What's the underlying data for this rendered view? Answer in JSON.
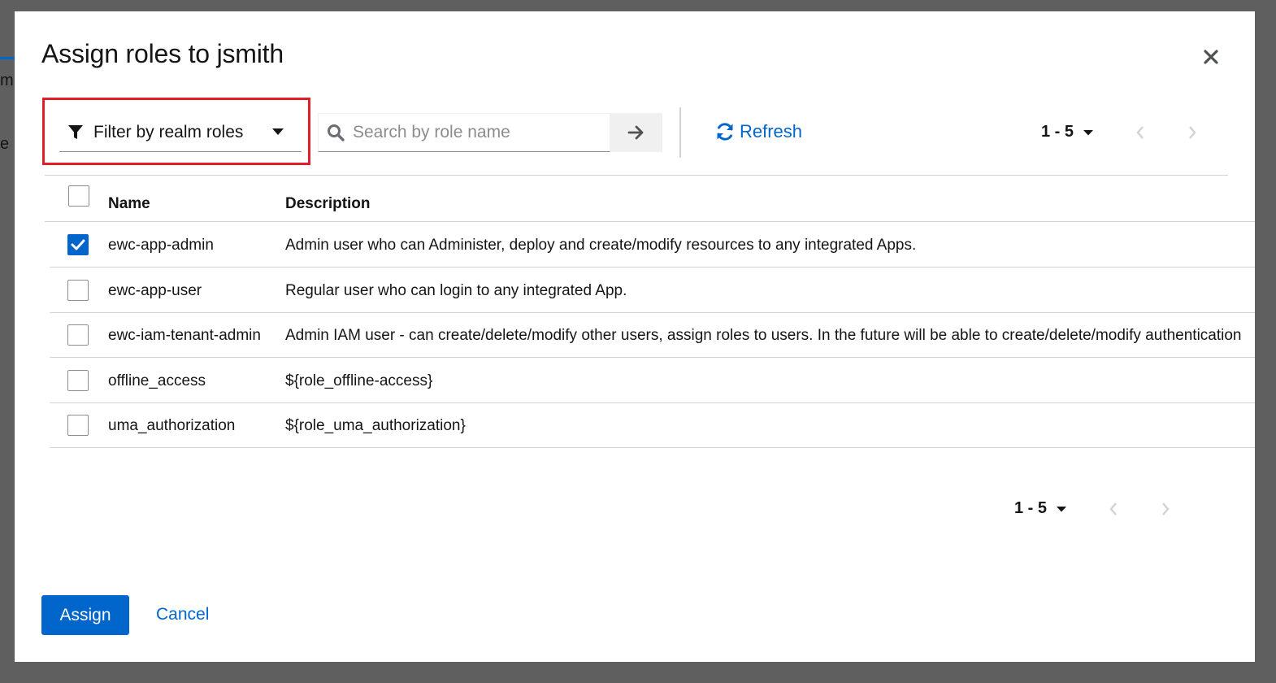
{
  "background_page": {
    "fragment_1": "m",
    "fragment_2": "e i"
  },
  "modal": {
    "title": "Assign roles to jsmith",
    "close_icon": "close-icon"
  },
  "toolbar": {
    "filter_label": "Filter by realm roles",
    "filter_icon": "filter-icon",
    "search_placeholder": "Search by role name",
    "search_value": "",
    "refresh_label": "Refresh",
    "pagination_range": "1 - 5"
  },
  "table": {
    "columns": [
      "Name",
      "Description"
    ],
    "rows": [
      {
        "name": "ewc-app-admin",
        "description": "Admin user who can Administer, deploy and create/modify resources to any integrated Apps.",
        "checked": true
      },
      {
        "name": "ewc-app-user",
        "description": "Regular user who can login to any integrated App.",
        "checked": false
      },
      {
        "name": "ewc-iam-tenant-admin",
        "description": "Admin IAM user - can create/delete/modify other users, assign roles to users. In the future will be able to create/delete/modify authentication",
        "checked": false
      },
      {
        "name": "offline_access",
        "description": "${role_offline-access}",
        "checked": false
      },
      {
        "name": "uma_authorization",
        "description": "${role_uma_authorization}",
        "checked": false
      }
    ]
  },
  "footer_pagination": {
    "range": "1 - 5"
  },
  "actions": {
    "assign_label": "Assign",
    "cancel_label": "Cancel"
  },
  "colors": {
    "primary": "#0066cc",
    "highlight": "#e01e2a",
    "overlay": "#5f5f5f"
  }
}
